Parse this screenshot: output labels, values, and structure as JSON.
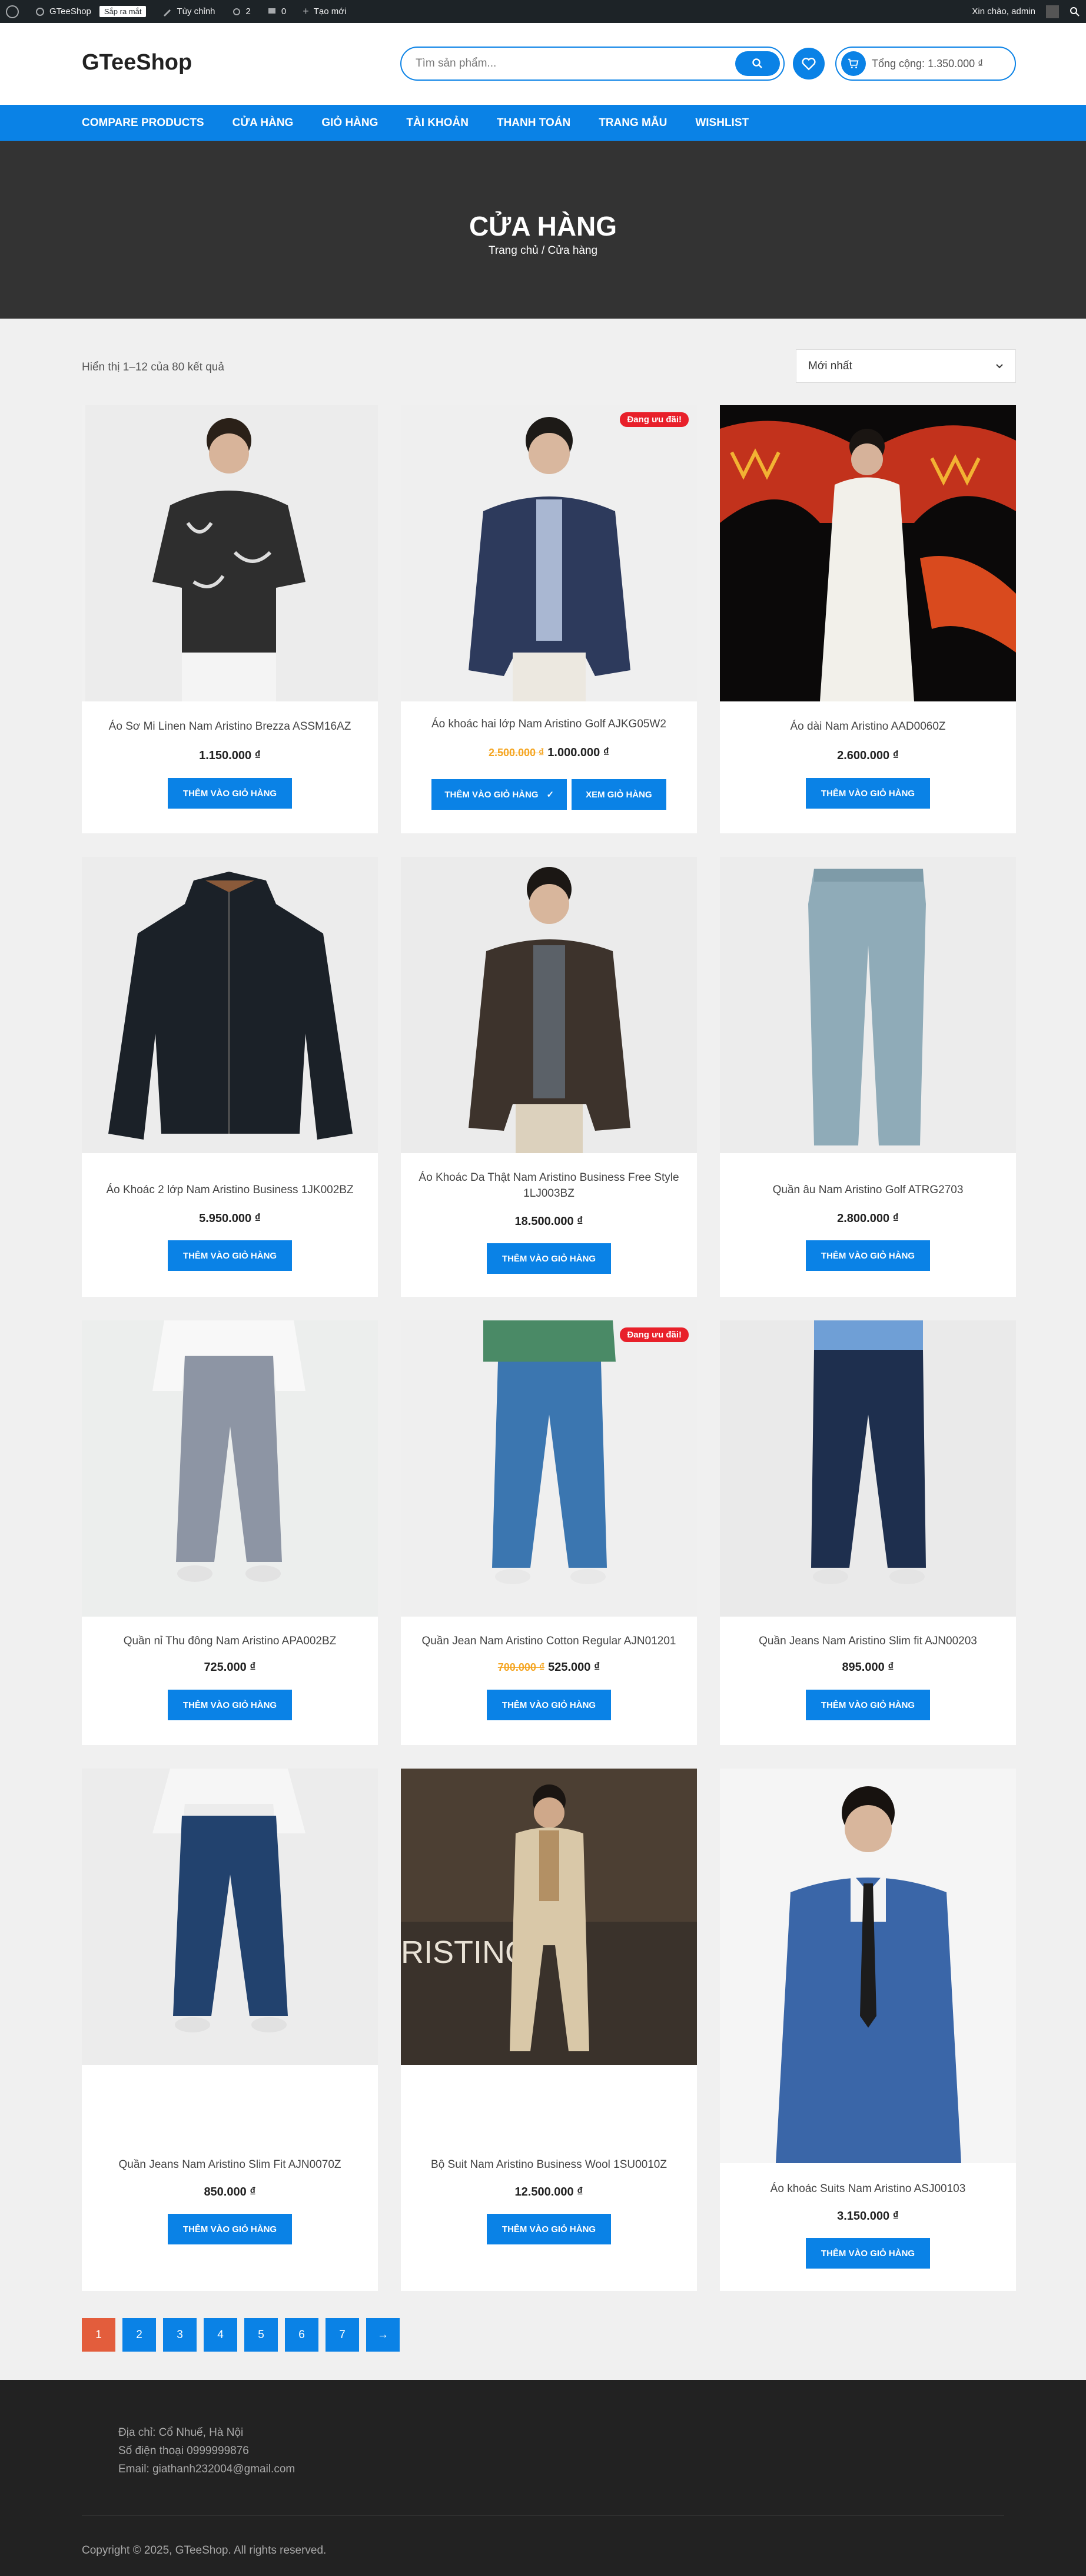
{
  "adminbar": {
    "site": "GTeeShop",
    "badge": "Sắp ra mắt",
    "customize": "Tùy chỉnh",
    "updates": "2",
    "comments": "0",
    "new": "Tạo mới",
    "greeting": "Xin chào, admin"
  },
  "header": {
    "logo": "GTeeShop",
    "search_placeholder": "Tìm sản phẩm...",
    "cart_total": "Tổng cộng: 1.350.000 ₫"
  },
  "nav": [
    "COMPARE PRODUCTS",
    "CỬA HÀNG",
    "GIỎ HÀNG",
    "TÀI KHOẢN",
    "THANH TOÁN",
    "TRANG MẪU",
    "WISHLIST"
  ],
  "hero": {
    "title": "CỬA HÀNG",
    "breadcrumb": "Trang chủ / Cửa hàng"
  },
  "toolbar": {
    "result_count": "Hiển thị 1–12 của 80 kết quả",
    "sort": "Mới nhất"
  },
  "products": [
    {
      "name": "Áo Sơ Mi Linen Nam Aristino Brezza ASSM16AZ",
      "price": "1.150.000 ₫",
      "button": "THÊM VÀO GIỎ HÀNG"
    },
    {
      "name": "Áo khoác hai lớp Nam Aristino Golf AJKG05W2",
      "old_price": "2.500.000 ₫",
      "price": "1.000.000 ₫",
      "button": "THÊM VÀO GIỎ HÀNG",
      "view_cart": "XEM GIỎ HÀNG",
      "sale": "Đang ưu đãi!"
    },
    {
      "name": "Áo dài Nam Aristino AAD0060Z",
      "price": "2.600.000 ₫",
      "button": "THÊM VÀO GIỎ HÀNG"
    },
    {
      "name": "Áo Khoác 2 lớp Nam Aristino Business 1JK002BZ",
      "price": "5.950.000 ₫",
      "button": "THÊM VÀO GIỎ HÀNG"
    },
    {
      "name": "Áo Khoác Da Thật Nam Aristino Business Free Style 1LJ003BZ",
      "price": "18.500.000 ₫",
      "button": "THÊM VÀO GIỎ HÀNG"
    },
    {
      "name": "Quần âu Nam Aristino Golf ATRG2703",
      "price": "2.800.000 ₫",
      "button": "THÊM VÀO GIỎ HÀNG"
    },
    {
      "name": "Quần nỉ Thu đông Nam Aristino APA002BZ",
      "price": "725.000 ₫",
      "button": "THÊM VÀO GIỎ HÀNG"
    },
    {
      "name": "Quần Jean Nam Aristino Cotton Regular AJN01201",
      "old_price": "700.000 ₫",
      "price": "525.000 ₫",
      "button": "THÊM VÀO GIỎ HÀNG",
      "sale": "Đang ưu đãi!"
    },
    {
      "name": "Quần Jeans Nam Aristino Slim fit AJN00203",
      "price": "895.000 ₫",
      "button": "THÊM VÀO GIỎ HÀNG"
    },
    {
      "name": "Quần Jeans Nam Aristino Slim Fit AJN0070Z",
      "price": "850.000 ₫",
      "button": "THÊM VÀO GIỎ HÀNG"
    },
    {
      "name": "Bộ Suit Nam Aristino Business Wool 1SU0010Z",
      "price": "12.500.000 ₫",
      "button": "THÊM VÀO GIỎ HÀNG"
    },
    {
      "name": "Áo khoác Suits Nam Aristino ASJ00103",
      "price": "3.150.000 ₫",
      "button": "THÊM VÀO GIỎ HÀNG"
    }
  ],
  "pagination": [
    "1",
    "2",
    "3",
    "4",
    "5",
    "6",
    "7",
    "→"
  ],
  "footer": {
    "address": "Địa chỉ: Cổ Nhuế, Hà Nội",
    "phone": "Số điện thoại 0999999876",
    "email": "Email: giathanh232004@gmail.com",
    "copyright": "Copyright © 2025, GTeeShop. All rights reserved."
  },
  "colors": {
    "primary": "#0a82e6",
    "sale": "#e8202a",
    "old_price": "#f5a623",
    "active_page": "#e35d3c"
  }
}
